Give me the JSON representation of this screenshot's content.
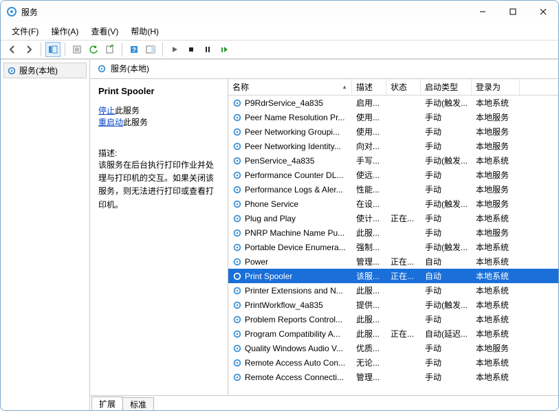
{
  "window": {
    "title": "服务"
  },
  "menu": {
    "file": "文件(F)",
    "action": "操作(A)",
    "view": "查看(V)",
    "help": "帮助(H)"
  },
  "tree": {
    "root_label": "服务(本地)"
  },
  "right_header": {
    "label": "服务(本地)"
  },
  "detail": {
    "selected_name": "Print Spooler",
    "stop_link_prefix": "停止",
    "stop_link_suffix": "此服务",
    "restart_link_prefix": "重启动",
    "restart_link_suffix": "此服务",
    "desc_label": "描述:",
    "desc_text": "该服务在后台执行打印作业并处理与打印机的交互。如果关闭该服务，则无法进行打印或查看打印机。"
  },
  "columns": {
    "name": "名称",
    "desc": "描述",
    "status": "状态",
    "startup": "启动类型",
    "logon": "登录为"
  },
  "rows": [
    {
      "name": "P9RdrService_4a835",
      "desc": "启用...",
      "status": "",
      "startup": "手动(触发...",
      "logon": "本地系统"
    },
    {
      "name": "Peer Name Resolution Pr...",
      "desc": "使用...",
      "status": "",
      "startup": "手动",
      "logon": "本地服务"
    },
    {
      "name": "Peer Networking Groupi...",
      "desc": "使用...",
      "status": "",
      "startup": "手动",
      "logon": "本地服务"
    },
    {
      "name": "Peer Networking Identity...",
      "desc": "向对...",
      "status": "",
      "startup": "手动",
      "logon": "本地服务"
    },
    {
      "name": "PenService_4a835",
      "desc": "手写...",
      "status": "",
      "startup": "手动(触发...",
      "logon": "本地系统"
    },
    {
      "name": "Performance Counter DL...",
      "desc": "使远...",
      "status": "",
      "startup": "手动",
      "logon": "本地服务"
    },
    {
      "name": "Performance Logs & Aler...",
      "desc": "性能...",
      "status": "",
      "startup": "手动",
      "logon": "本地服务"
    },
    {
      "name": "Phone Service",
      "desc": "在设...",
      "status": "",
      "startup": "手动(触发...",
      "logon": "本地服务"
    },
    {
      "name": "Plug and Play",
      "desc": "使计...",
      "status": "正在...",
      "startup": "手动",
      "logon": "本地系统"
    },
    {
      "name": "PNRP Machine Name Pu...",
      "desc": "此服...",
      "status": "",
      "startup": "手动",
      "logon": "本地服务"
    },
    {
      "name": "Portable Device Enumera...",
      "desc": "强制...",
      "status": "",
      "startup": "手动(触发...",
      "logon": "本地系统"
    },
    {
      "name": "Power",
      "desc": "管理...",
      "status": "正在...",
      "startup": "自动",
      "logon": "本地系统"
    },
    {
      "name": "Print Spooler",
      "desc": "该服...",
      "status": "正在...",
      "startup": "自动",
      "logon": "本地系统",
      "selected": true
    },
    {
      "name": "Printer Extensions and N...",
      "desc": "此服...",
      "status": "",
      "startup": "手动",
      "logon": "本地系统"
    },
    {
      "name": "PrintWorkflow_4a835",
      "desc": "提供...",
      "status": "",
      "startup": "手动(触发...",
      "logon": "本地系统"
    },
    {
      "name": "Problem Reports Control...",
      "desc": "此服...",
      "status": "",
      "startup": "手动",
      "logon": "本地系统"
    },
    {
      "name": "Program Compatibility A...",
      "desc": "此服...",
      "status": "正在...",
      "startup": "自动(延迟...",
      "logon": "本地系统"
    },
    {
      "name": "Quality Windows Audio V...",
      "desc": "优质...",
      "status": "",
      "startup": "手动",
      "logon": "本地服务"
    },
    {
      "name": "Remote Access Auto Con...",
      "desc": "无论...",
      "status": "",
      "startup": "手动",
      "logon": "本地系统"
    },
    {
      "name": "Remote Access Connecti...",
      "desc": "管理...",
      "status": "",
      "startup": "手动",
      "logon": "本地系统"
    }
  ],
  "tabs": {
    "extended": "扩展",
    "standard": "标准"
  }
}
